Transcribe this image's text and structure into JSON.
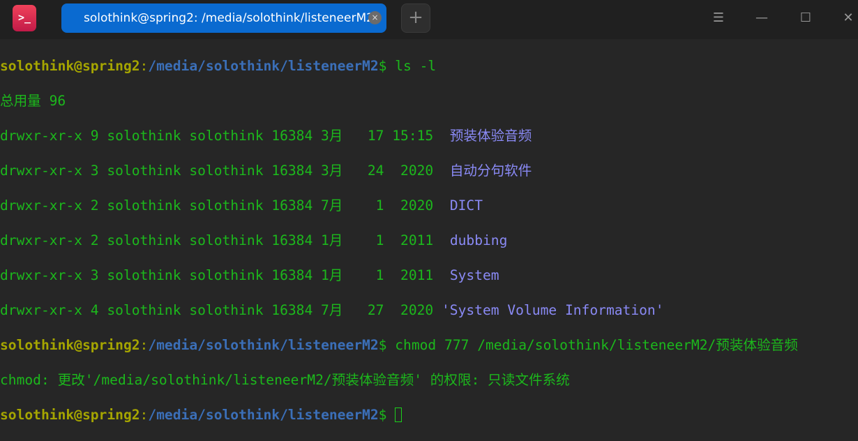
{
  "window": {
    "tab_title": "solothink@spring2: /media/solothink/listeneerM2",
    "new_tab": "+",
    "close": "×",
    "menu": "☰",
    "minimize": "—",
    "maximize": "☐",
    "exit": "✕",
    "app_icon": ">_"
  },
  "colors": {
    "text": "#1cb81c",
    "user": "#a5a500",
    "path": "#3b6fb8",
    "dir": "#8a8af5",
    "tab": "#0a6ad0"
  },
  "prompt": {
    "user": "solothink@spring2",
    "colon": ":",
    "path": "/media/solothink/listeneerM2",
    "dollar": "$"
  },
  "lines": {
    "cmd1": " ls -l",
    "total": "总用量 96",
    "rows": [
      {
        "meta": "drwxr-xr-x 9 solothink solothink 16384 3月   17 15:15  ",
        "name": "预装体验音频"
      },
      {
        "meta": "drwxr-xr-x 3 solothink solothink 16384 3月   24  2020  ",
        "name": "自动分句软件"
      },
      {
        "meta": "drwxr-xr-x 2 solothink solothink 16384 7月    1  2020  ",
        "name": "DICT"
      },
      {
        "meta": "drwxr-xr-x 2 solothink solothink 16384 1月    1  2011  ",
        "name": "dubbing"
      },
      {
        "meta": "drwxr-xr-x 3 solothink solothink 16384 1月    1  2011  ",
        "name": "System"
      },
      {
        "meta": "drwxr-xr-x 4 solothink solothink 16384 7月   27  2020 ",
        "name": "'System Volume Information'"
      }
    ],
    "cmd2": " chmod 777 /media/solothink/listeneerM2/预装体验音频",
    "error": "chmod: 更改'/media/solothink/listeneerM2/预装体验音频' 的权限: 只读文件系统"
  }
}
